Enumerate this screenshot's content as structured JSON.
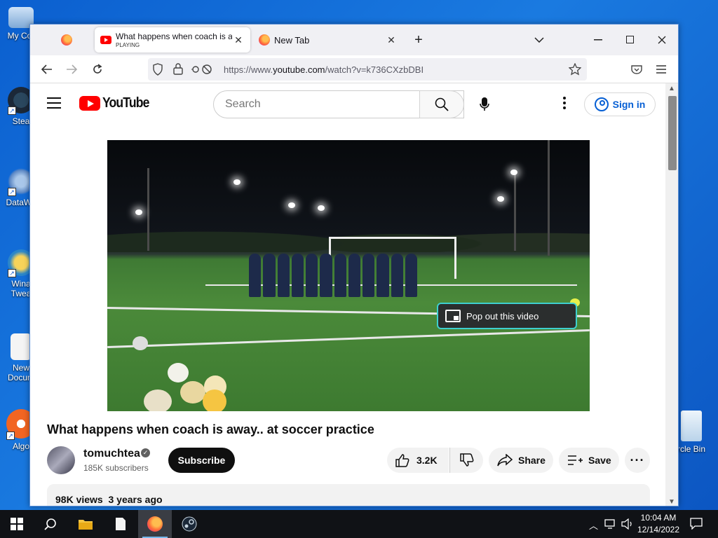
{
  "desktop": {
    "icons": [
      {
        "label": "My Cor",
        "color": "#cfe3f7"
      },
      {
        "label": "Stea",
        "color": "#1b2838"
      },
      {
        "label": "DataWa",
        "color": "#7aa8d8"
      },
      {
        "label": "Wina\nTwea",
        "color": "#f2b21c"
      },
      {
        "label": "New\nDocum",
        "color": "#f4f4f4"
      },
      {
        "label": "Algo",
        "color": "#f26522"
      },
      {
        "label": "rcle Bin",
        "color": "#d9e7f4"
      }
    ]
  },
  "browser": {
    "tabs": [
      {
        "title": "What happens when coach is away",
        "subtitle": "PLAYING"
      },
      {
        "title": "New Tab"
      }
    ],
    "url_prefix": "https://www.",
    "url_domain": "youtube.com",
    "url_path": "/watch?v=k736CXzbDBI"
  },
  "youtube": {
    "logo_text": "YouTube",
    "search_placeholder": "Search",
    "signin_label": "Sign in",
    "popout_label": "Pop out this video",
    "video_title": "What happens when coach is away.. at soccer practice",
    "channel_name": "tomuchtea",
    "subscribers": "185K subscribers",
    "subscribe_label": "Subscribe",
    "likes": "3.2K",
    "share_label": "Share",
    "save_label": "Save",
    "views": "98K views",
    "posted": "3 years ago"
  },
  "taskbar": {
    "time": "10:04 AM",
    "date": "12/14/2022"
  },
  "colors": {
    "youtube_red": "#ff0000",
    "link_blue": "#065fd4",
    "desktop_blue": "#0b5fcf",
    "popout_border": "#3ecfcf"
  }
}
